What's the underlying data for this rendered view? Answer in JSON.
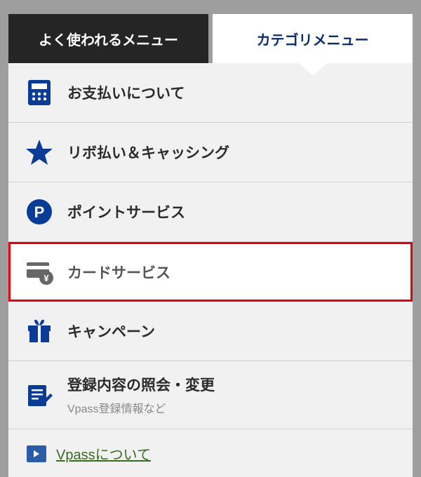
{
  "tabs": {
    "inactive_label": "よく使われるメニュー",
    "active_label": "カテゴリメニュー"
  },
  "menu": [
    {
      "id": "payment",
      "label": "お支払いについて",
      "sublabel": null,
      "highlight": false
    },
    {
      "id": "revolving",
      "label": "リボ払い＆キャッシング",
      "sublabel": null,
      "highlight": false
    },
    {
      "id": "points",
      "label": "ポイントサービス",
      "sublabel": null,
      "highlight": false
    },
    {
      "id": "card",
      "label": "カードサービス",
      "sublabel": null,
      "highlight": true
    },
    {
      "id": "campaign",
      "label": "キャンペーン",
      "sublabel": null,
      "highlight": false
    },
    {
      "id": "register",
      "label": "登録内容の照会・変更",
      "sublabel": "Vpass登録情報など",
      "highlight": false
    }
  ],
  "link": {
    "label": "Vpassについて"
  },
  "colors": {
    "brand": "#0a3b96"
  }
}
